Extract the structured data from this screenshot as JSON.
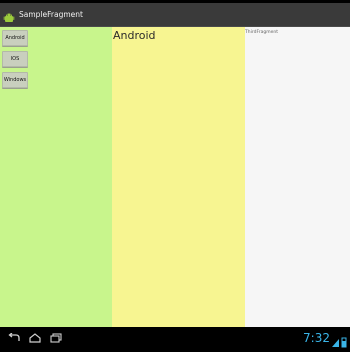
{
  "app": {
    "title": "SampleFragment"
  },
  "left_panel": {
    "buttons": [
      {
        "label": "Android"
      },
      {
        "label": "IOS"
      },
      {
        "label": "Windows"
      }
    ]
  },
  "middle_panel": {
    "title": "Android"
  },
  "right_panel": {
    "label": "ThirdFragment"
  },
  "status": {
    "time": "7:32"
  },
  "colors": {
    "left_panel": "#c8f58c",
    "middle_panel": "#f7f591",
    "right_panel": "#f6f6f6",
    "clock": "#3ab5e8"
  },
  "icons": {
    "app": "android-app-icon",
    "back": "back-icon",
    "home": "home-icon",
    "recent": "recent-apps-icon",
    "status": "status-indicators-icon"
  }
}
